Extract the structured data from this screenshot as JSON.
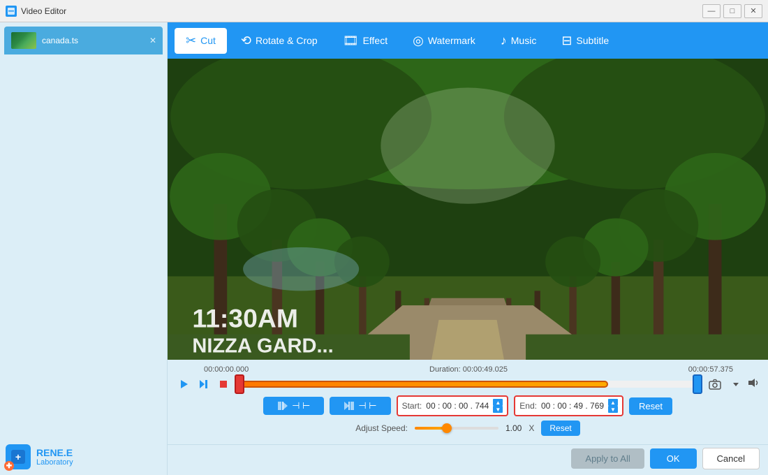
{
  "window": {
    "title": "Video Editor",
    "controls": {
      "minimize": "—",
      "maximize": "□",
      "close": "✕"
    }
  },
  "file_tab": {
    "name": "canada.ts",
    "close": "✕"
  },
  "nav_tabs": [
    {
      "id": "cut",
      "label": "Cut",
      "icon": "✂",
      "active": true
    },
    {
      "id": "rotate_crop",
      "label": "Rotate & Crop",
      "icon": "⟲",
      "active": false
    },
    {
      "id": "effect",
      "label": "Effect",
      "icon": "🎞",
      "active": false
    },
    {
      "id": "watermark",
      "label": "Watermark",
      "icon": "◎",
      "active": false
    },
    {
      "id": "music",
      "label": "Music",
      "icon": "♪",
      "active": false
    },
    {
      "id": "subtitle",
      "label": "Subtitle",
      "icon": "⊟",
      "active": false
    }
  ],
  "timeline": {
    "start_time": "00:00:00.000",
    "duration_label": "Duration: 00:00:49.025",
    "end_time": "00:00:57.375"
  },
  "cut_controls": {
    "start_value": "00 : 00 : 00 . 744",
    "end_value": "00 : 00 : 49 . 769",
    "start_label": "Start:",
    "end_label": "End:",
    "reset_label": "Reset"
  },
  "speed": {
    "label": "Adjust Speed:",
    "value": "1.00",
    "unit": "X",
    "reset_label": "Reset"
  },
  "actions": {
    "apply_all": "Apply to All",
    "ok": "OK",
    "cancel": "Cancel"
  },
  "logo": {
    "name": "RENE.E",
    "sub": "Laboratory"
  },
  "video": {
    "time_overlay": "11:30AM",
    "location_overlay": "NIZZA GARD..."
  }
}
